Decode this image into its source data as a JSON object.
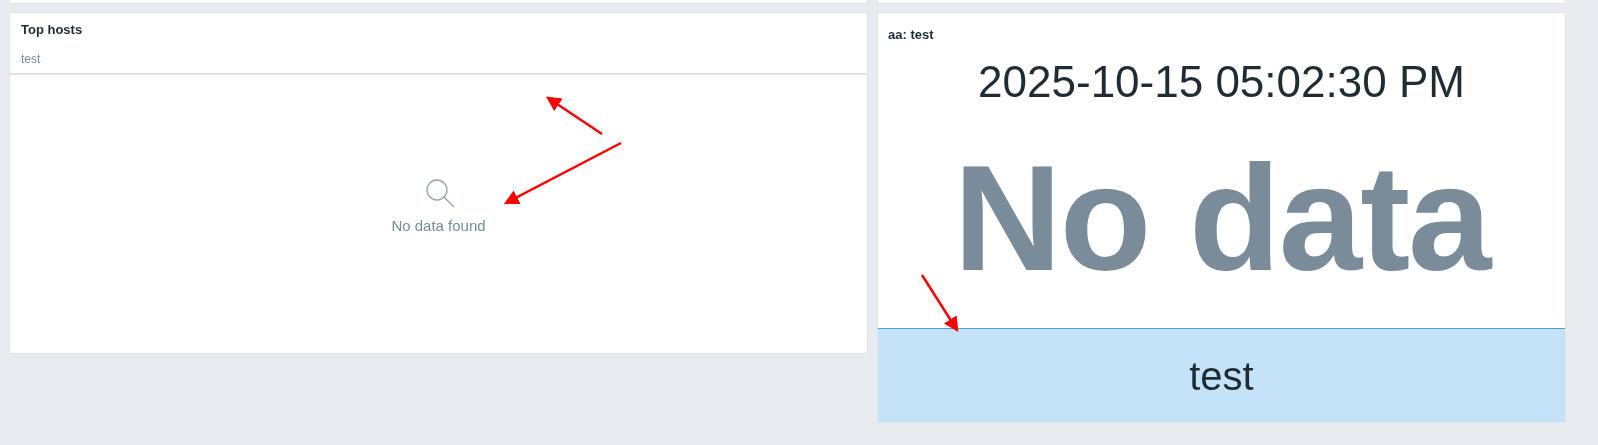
{
  "top_hosts": {
    "title": "Top hosts",
    "subtitle": "test",
    "empty_message": "No data found"
  },
  "clock_widget": {
    "title": "aa: test",
    "datetime": "2025-10-15 05:02:30 PM",
    "value": "No data",
    "footer": "test"
  }
}
